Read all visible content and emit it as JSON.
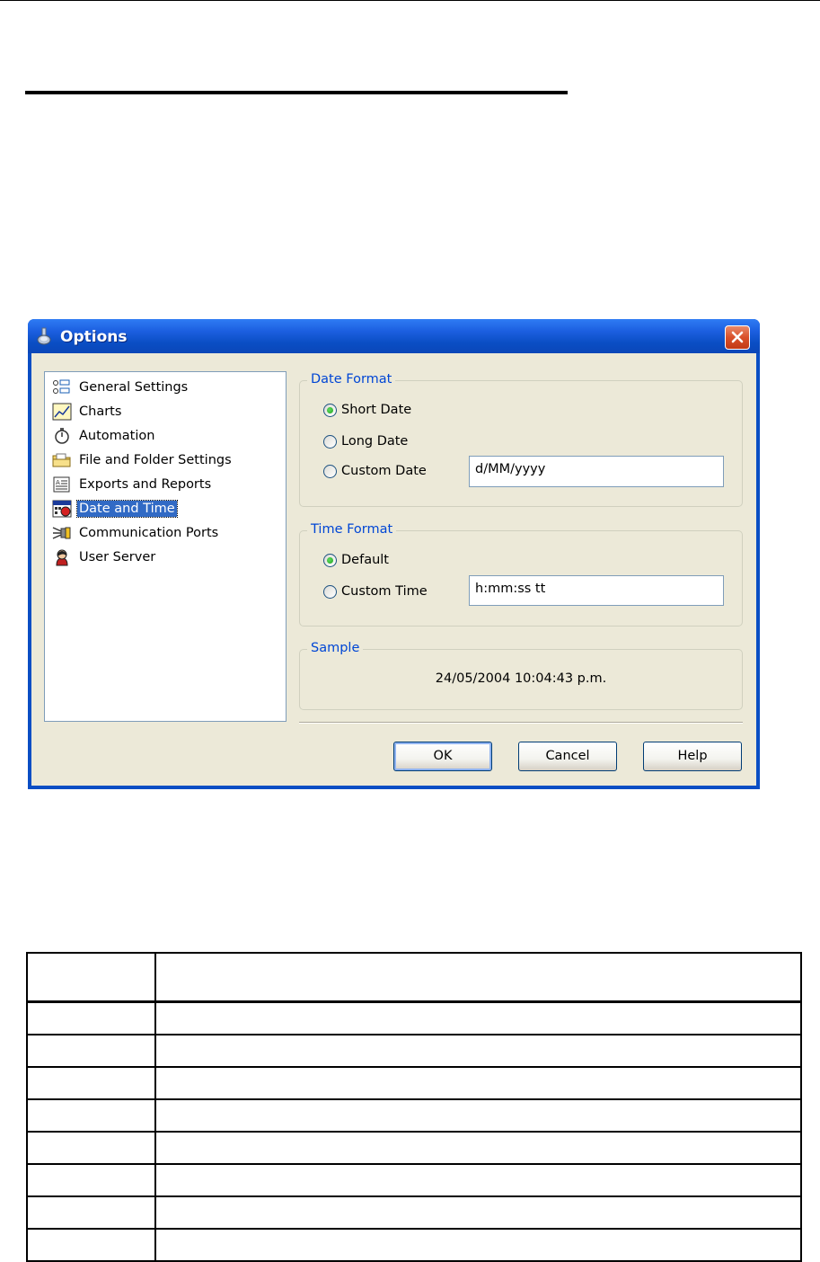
{
  "dialog": {
    "title": "Options",
    "close_icon": "close-icon"
  },
  "sidebar": {
    "items": [
      {
        "label": "General Settings",
        "icon": "settings-list-icon"
      },
      {
        "label": "Charts",
        "icon": "chart-icon"
      },
      {
        "label": "Automation",
        "icon": "stopwatch-icon"
      },
      {
        "label": "File and Folder Settings",
        "icon": "folder-icon"
      },
      {
        "label": "Exports and Reports",
        "icon": "report-icon"
      },
      {
        "label": "Date and Time",
        "icon": "calendar-clock-icon",
        "selected": true
      },
      {
        "label": "Communication Ports",
        "icon": "port-icon"
      },
      {
        "label": "User Server",
        "icon": "user-icon"
      }
    ]
  },
  "date_format": {
    "title": "Date Format",
    "short_date": "Short Date",
    "long_date": "Long Date",
    "custom_date": "Custom Date",
    "custom_date_value": "d/MM/yyyy",
    "selected": "Short Date"
  },
  "time_format": {
    "title": "Time Format",
    "default": "Default",
    "custom_time": "Custom Time",
    "custom_time_value": "h:mm:ss tt",
    "selected": "Default"
  },
  "sample": {
    "title": "Sample",
    "value": "24/05/2004 10:04:43 p.m."
  },
  "buttons": {
    "ok": "OK",
    "cancel": "Cancel",
    "help": "Help"
  },
  "colors": {
    "title_bar": "#0a4ec4",
    "dialog_face": "#ece9d8",
    "group_title": "#0046d5",
    "selection": "#316ac5"
  }
}
